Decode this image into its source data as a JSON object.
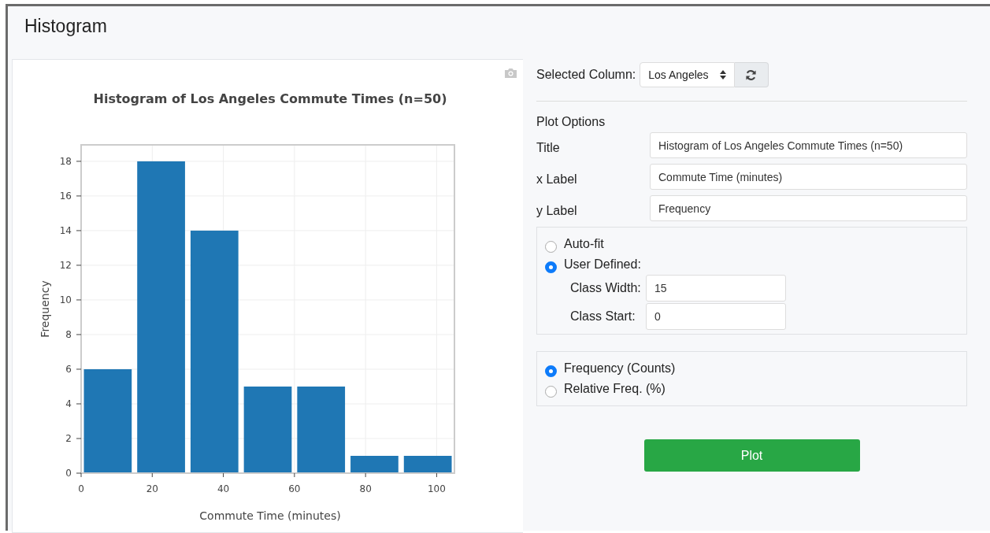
{
  "page": {
    "title": "Histogram"
  },
  "chart": {
    "chart_data": {
      "type": "bar",
      "title": "Histogram of Los Angeles Commute Times (n=50)",
      "xlabel": "Commute Time (minutes)",
      "ylabel": "Frequency",
      "x": [
        7.5,
        22.5,
        37.5,
        52.5,
        67.5,
        82.5,
        97.5
      ],
      "series": [
        {
          "color": "#1f77b4",
          "values": [
            6,
            18,
            14,
            5,
            5,
            1,
            1
          ]
        }
      ],
      "grid": true,
      "xlim": [
        0,
        105
      ],
      "ylim": [
        0,
        18.95
      ],
      "xticks": [
        0,
        20,
        40,
        60,
        80,
        100
      ],
      "yticks": [
        0,
        2,
        4,
        6,
        8,
        10,
        12,
        14,
        16,
        18
      ]
    }
  },
  "controls": {
    "column_label": "Selected Column:",
    "column_value": "Los Angeles",
    "section_title": "Plot Options",
    "fields": [
      {
        "label": "Title",
        "value": "Histogram of Los Angeles Commute Times (n=50)"
      },
      {
        "label": "x Label",
        "value": "Commute Time (minutes)"
      },
      {
        "label": "y Label",
        "value": "Frequency"
      }
    ],
    "bin_options": [
      {
        "label": "Auto-fit",
        "selected": false
      },
      {
        "label": "User Defined:",
        "selected": true
      }
    ],
    "bin_fields": [
      {
        "label": "Class Width:",
        "value": "15"
      },
      {
        "label": "Class Start:",
        "value": "0"
      }
    ],
    "scale_options": [
      {
        "label": "Frequency (Counts)",
        "selected": true
      },
      {
        "label": "Relative Freq. (%)",
        "selected": false
      }
    ],
    "plot_button": "Plot"
  }
}
